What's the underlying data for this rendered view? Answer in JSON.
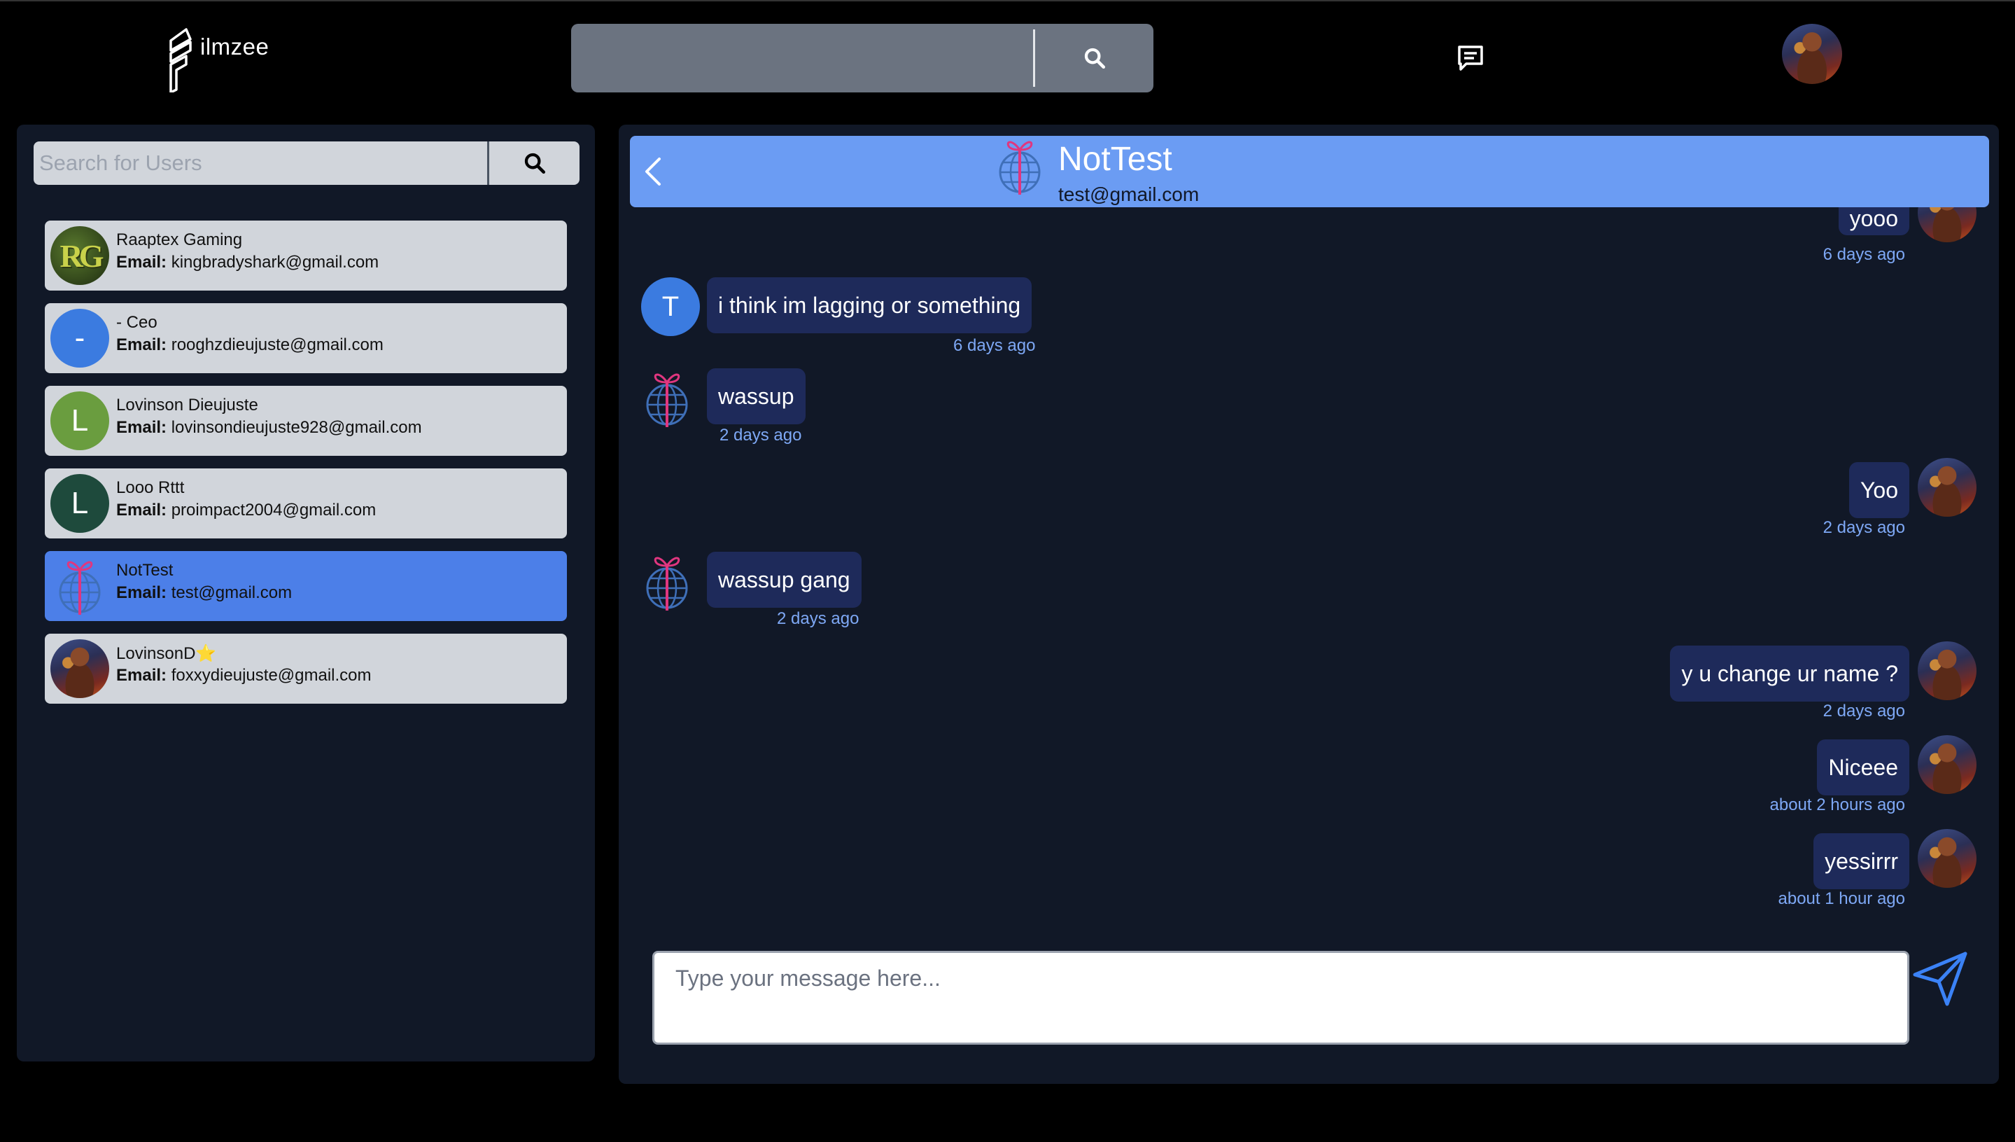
{
  "app": {
    "name": "ilmzee"
  },
  "topbar": {
    "search_value": ""
  },
  "sidebar": {
    "search_placeholder": "Search for Users",
    "email_label": "Email:",
    "users": [
      {
        "name": "Raaptex Gaming",
        "email": "kingbradyshark@gmail.com",
        "avatar": "rg-logo",
        "active": false
      },
      {
        "name": "- Ceo",
        "email": "rooghzdieujuste@gmail.com",
        "avatar": "letter",
        "letter": "-",
        "color": "#3b7be0",
        "active": false
      },
      {
        "name": "Lovinson Dieujuste",
        "email": "lovinsondieujuste928@gmail.com",
        "avatar": "letter",
        "letter": "L",
        "color": "#6a9d3f",
        "active": false
      },
      {
        "name": "Looo Rttt",
        "email": "proimpact2004@gmail.com",
        "avatar": "letter",
        "letter": "L",
        "color": "#1e4a3c",
        "active": false
      },
      {
        "name": "NotTest",
        "email": "test@gmail.com",
        "avatar": "gift-globe",
        "active": true
      },
      {
        "name": "LovinsonD⭐",
        "email": "foxxydieujuste@gmail.com",
        "avatar": "warrior-photo",
        "active": false
      }
    ]
  },
  "chat": {
    "contact_name": "NotTest",
    "contact_email": "test@gmail.com",
    "messages": [
      {
        "text": "yooo",
        "time": "6 days ago",
        "side": "right",
        "avatar": "warrior-photo"
      },
      {
        "text": "i think im lagging or something",
        "time": "6 days ago",
        "side": "left",
        "avatar": "letter",
        "letter": "T"
      },
      {
        "text": "wassup",
        "time": "2 days ago",
        "side": "left",
        "avatar": "gift-globe"
      },
      {
        "text": "Yoo",
        "time": "2 days ago",
        "side": "right",
        "avatar": "warrior-photo"
      },
      {
        "text": "wassup gang",
        "time": "2 days ago",
        "side": "left",
        "avatar": "gift-globe"
      },
      {
        "text": "y u change ur name ?",
        "time": "2 days ago",
        "side": "right",
        "avatar": "warrior-photo"
      },
      {
        "text": "Niceee",
        "time": "about 2 hours ago",
        "side": "right",
        "avatar": "warrior-photo"
      },
      {
        "text": "yessirrr",
        "time": "about 1 hour ago",
        "side": "right",
        "avatar": "warrior-photo"
      }
    ],
    "composer_placeholder": "Type your message here...",
    "composer_value": ""
  },
  "colors": {
    "accent": "#4c7fe8",
    "header": "#6b9cf3",
    "panel": "#111827",
    "bubble": "#1e2a5a",
    "timestamp": "#7ea8f5"
  },
  "icons": [
    "logo-icon",
    "search-icon",
    "message-icon",
    "back-icon",
    "send-icon",
    "gift-globe-icon"
  ]
}
